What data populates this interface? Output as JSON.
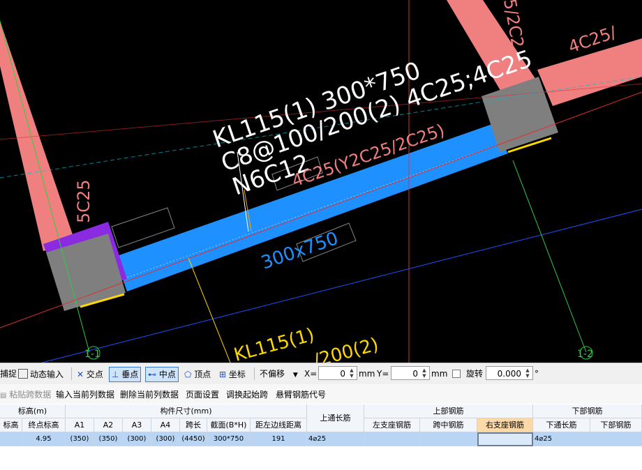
{
  "drawing": {
    "beam_name": "KL115(1) 300*750",
    "stirrup": "C8@100/200(2) 4C25;4C25",
    "waist_bar": "N6C12",
    "original_support_bar": "4C25(Y2C25/2C25)",
    "section_label": "300x750",
    "left_column_bar": "5C25",
    "right_column_bar_top": "4C25/",
    "right_column_bar_vertical": "5/2C2",
    "axis_left": "1-1",
    "axis_right": "1-2",
    "lower_beam_name": "KL115(1)",
    "lower_beam_stirrup": "/200(2)"
  },
  "snapbar": {
    "capture_label": "捕捉",
    "dynamic_input_label": "动态输入",
    "intersection_label": "交点",
    "perpendicular_label": "垂点",
    "midpoint_label": "中点",
    "vertex_label": "顶点",
    "coordinate_label": "坐标",
    "offset_select": "不偏移",
    "x_label": "X=",
    "x_value": "0",
    "x_unit": "mm",
    "y_label": "Y=",
    "y_value": "0",
    "y_unit": "mm",
    "rotate_label": "旋转",
    "rotate_value": "0.000",
    "degree_symbol": "°"
  },
  "toolbar": {
    "paste_span_data": "粘贴跨数据",
    "input_current_column": "输入当前列数据",
    "delete_current_column": "删除当前列数据",
    "page_setup": "页面设置",
    "swap_start_span": "调换起始跨",
    "cantilever_rebar_code": "悬臂钢筋代号"
  },
  "table": {
    "group_headers": {
      "elevation": "标高(m)",
      "member_size": "构件尺寸(mm)",
      "top_through_bar": "上通长筋",
      "top_rebar": "上部钢筋",
      "bottom_rebar": "下部钢筋"
    },
    "columns": {
      "start_elevation": "标高",
      "end_elevation": "终点标高",
      "a1": "A1",
      "a2": "A2",
      "a3": "A3",
      "a4": "A4",
      "span_length": "跨长",
      "section": "截面(B*H)",
      "left_edge_distance": "距左边线距离",
      "left_support_bar": "左支座钢筋",
      "mid_span_bar": "跨中钢筋",
      "right_support_bar": "右支座钢筋",
      "bottom_through_bar": "下通长筋",
      "bottom_bar": "下部钢筋"
    },
    "row": {
      "end_elevation": "4.95",
      "a1": "(350)",
      "a2": "(350)",
      "a3": "(300)",
      "a4": "(300)",
      "span_length": "(4450)",
      "section": "300*750",
      "left_edge_distance": "191",
      "top_through_bar": "4⌀25",
      "left_support_bar": "",
      "mid_span_bar": "",
      "right_support_bar": "",
      "bottom_through_bar": "4⌀25",
      "bottom_bar": ""
    }
  },
  "colors": {
    "canvas_bg": "#000000",
    "beam_blue": "#1e90ff",
    "beam_pink": "#f08080",
    "column_gray": "#7f7f7f",
    "column_purple": "#8a2be2",
    "axis_red": "#e03030",
    "axis_green": "#2ecc40",
    "label_white": "#ffffff",
    "label_yellow": "#ffd700",
    "header_highlight": "#fbd9a8"
  }
}
